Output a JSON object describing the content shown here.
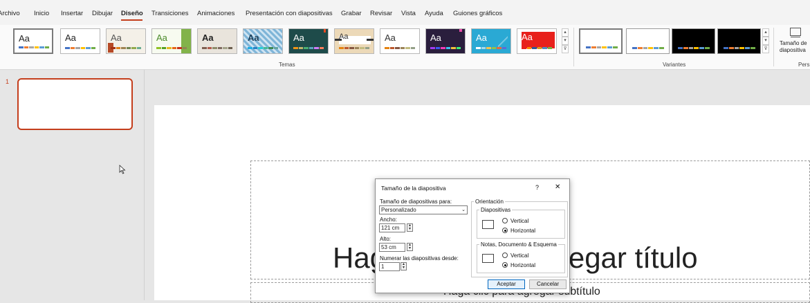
{
  "menu": [
    "Archivo",
    "Inicio",
    "Insertar",
    "Dibujar",
    "Diseño",
    "Transiciones",
    "Animaciones",
    "Presentación con diapositivas",
    "Grabar",
    "Revisar",
    "Vista",
    "Ayuda",
    "Guiones gráficos"
  ],
  "ribbon": {
    "theme_glyph": "Aa",
    "themes_label": "Temas",
    "variants_label": "Variantes",
    "slide_size_label_1": "Tamaño de",
    "slide_size_label_2": "diapositiva",
    "customize_label": "Pers"
  },
  "thumbnail": {
    "number": "1"
  },
  "slide": {
    "title": "Haga clic para agregar título",
    "subtitle": "Haga clic para agregar subtítulo"
  },
  "dialog": {
    "title": "Tamaño de la diapositiva",
    "help": "?",
    "close": "✕",
    "size_for_label": "Tamaño de diapositivas para:",
    "size_for_value": "Personalizado",
    "width_label": "Ancho:",
    "width_value": "121 cm",
    "height_label": "Alto:",
    "height_value": "53 cm",
    "number_from_label": "Numerar las diapositivas desde:",
    "number_from_value": "1",
    "orientation_label": "Orientación",
    "slides_label": "Diapositivas",
    "notes_label": "Notas, Documento & Esquema",
    "vertical": "Vertical",
    "horizontal": "Horizontal",
    "ok": "Aceptar",
    "cancel": "Cancelar"
  },
  "colors": {
    "accent": "#c43e1c",
    "default_button": "#0067c0"
  }
}
